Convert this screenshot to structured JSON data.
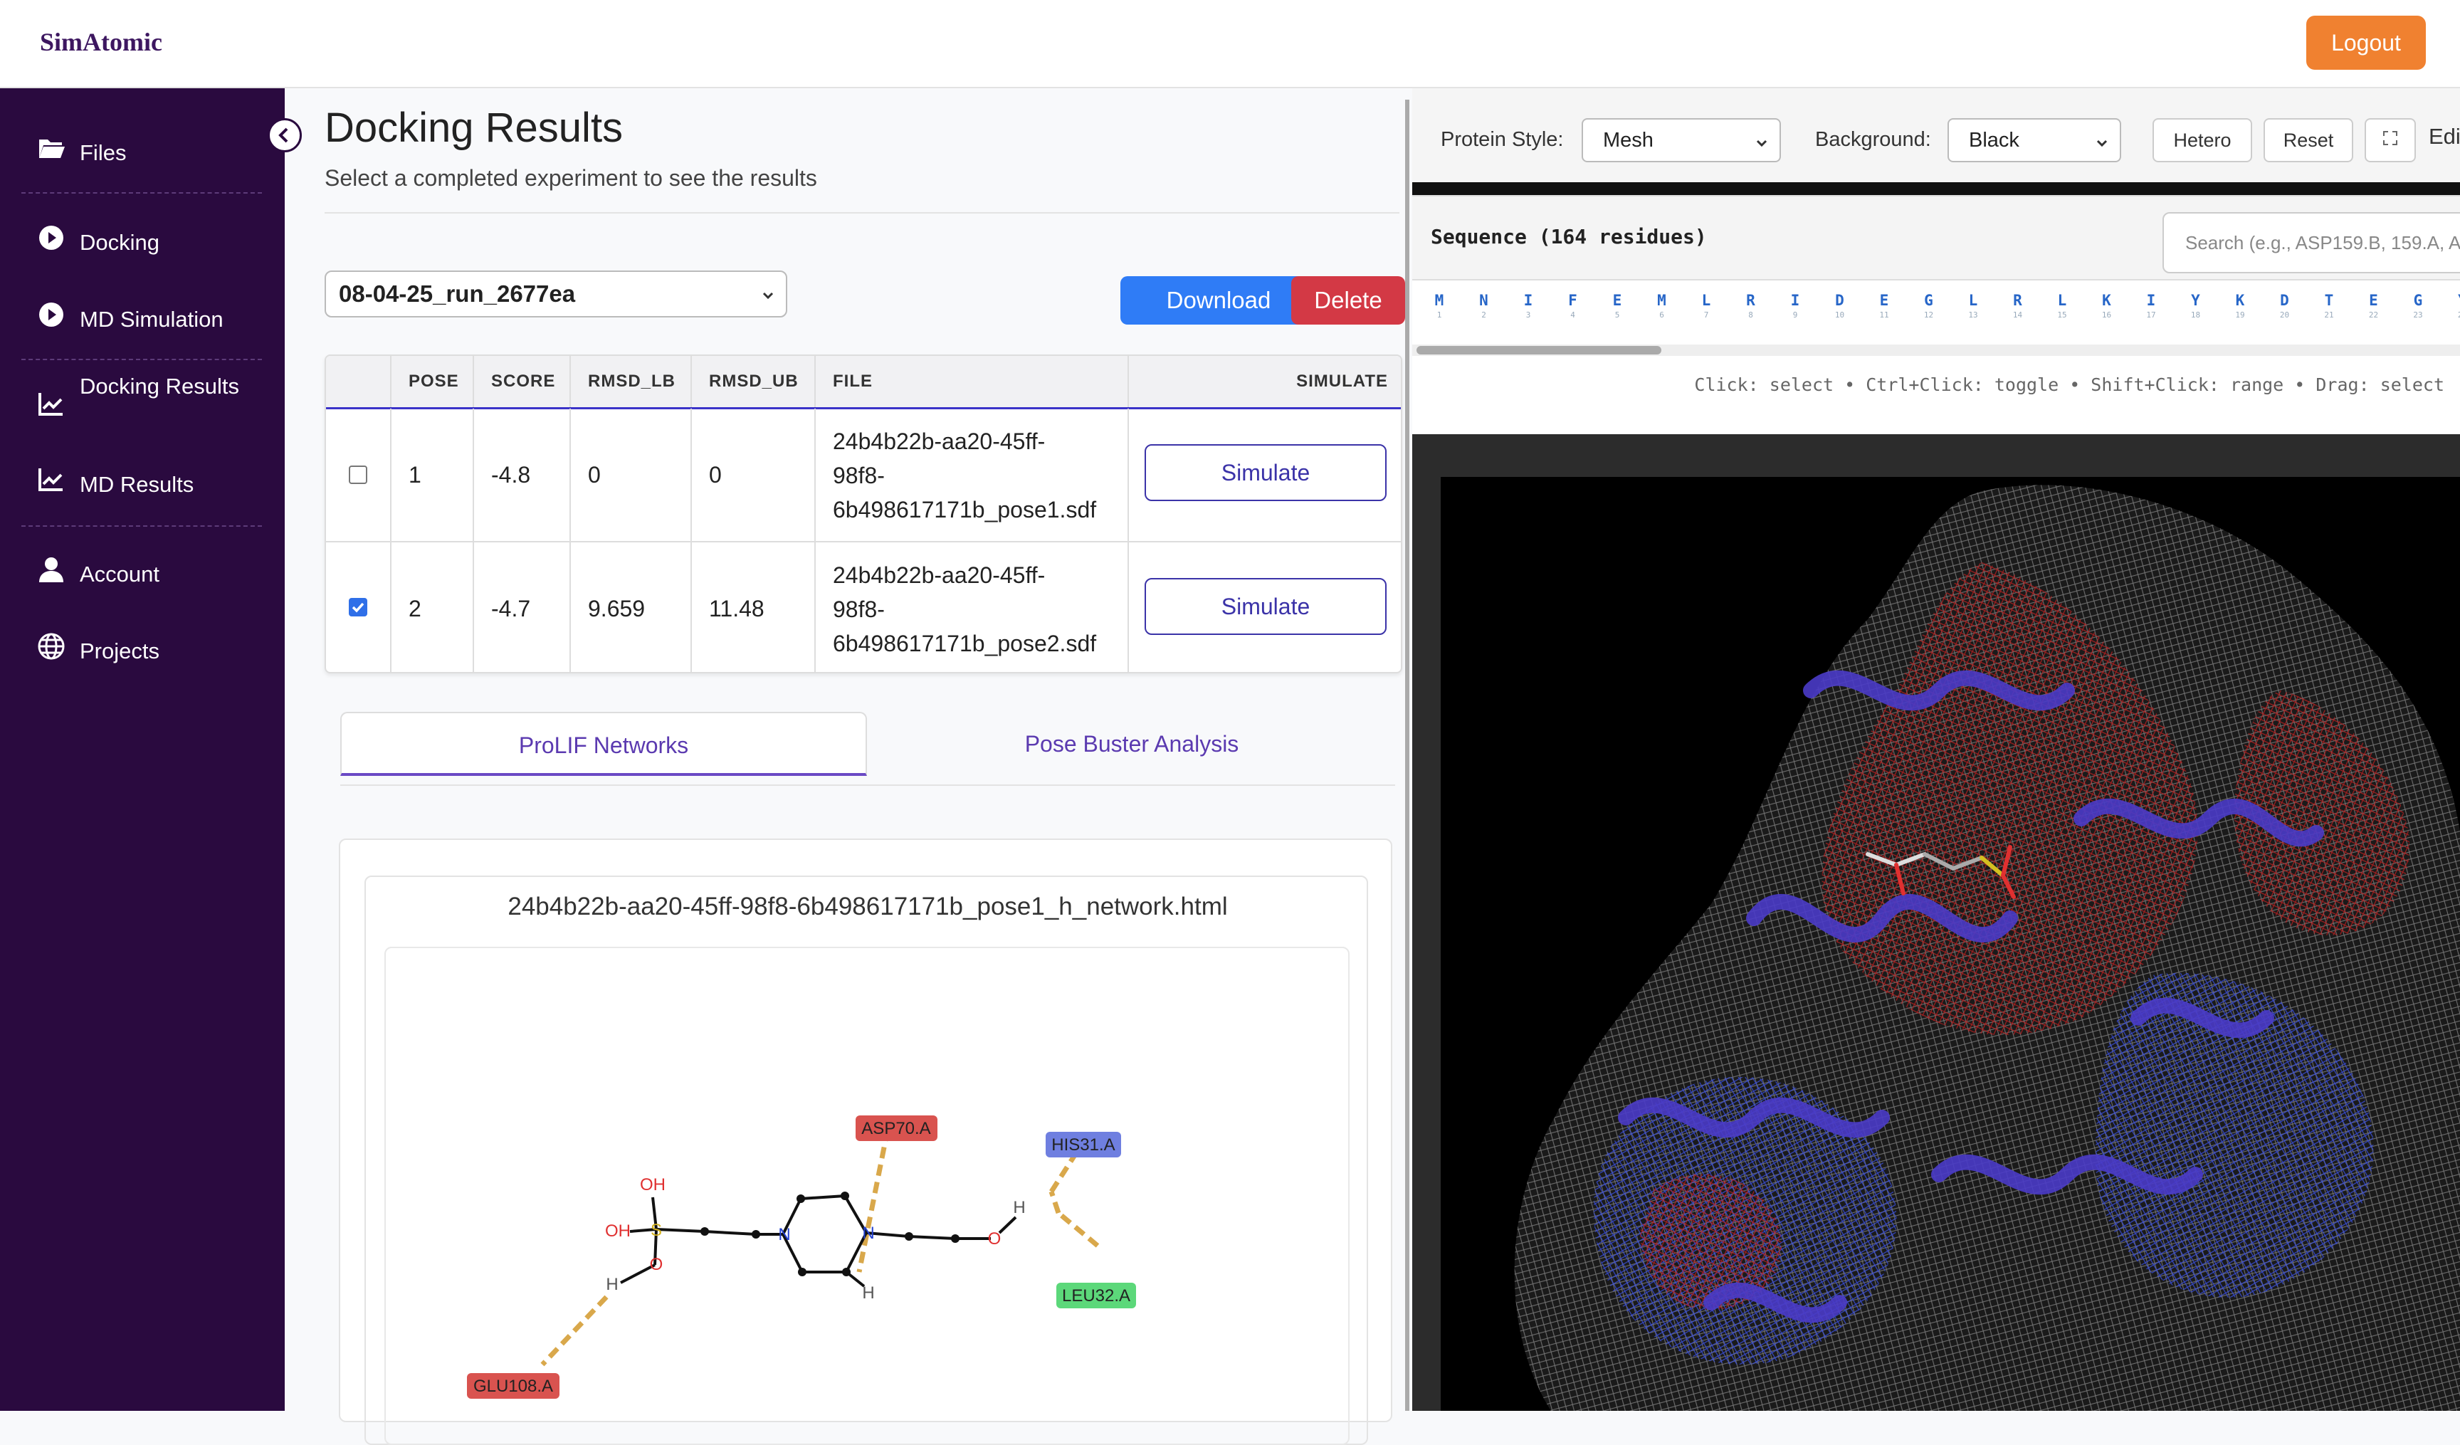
{
  "header": {
    "brand": "SimAtomic",
    "logout_label": "Logout"
  },
  "sidebar": {
    "items": [
      {
        "label": "Files",
        "icon": "folder-open-icon"
      },
      {
        "label": "Docking",
        "icon": "play-circle-icon"
      },
      {
        "label": "MD Simulation",
        "icon": "play-circle-icon"
      },
      {
        "label": "Docking Results",
        "icon": "chart-line-icon"
      },
      {
        "label": "MD Results",
        "icon": "chart-line-icon"
      },
      {
        "label": "Account",
        "icon": "user-icon"
      },
      {
        "label": "Projects",
        "icon": "globe-icon"
      }
    ]
  },
  "main": {
    "title": "Docking Results",
    "subtitle": "Select a completed experiment to see the results",
    "experiment": "08-04-25_run_2677ea",
    "download_label": "Download",
    "delete_label": "Delete",
    "table": {
      "headers": [
        "",
        "POSE",
        "SCORE",
        "RMSD_LB",
        "RMSD_UB",
        "FILE",
        "SIMULATE"
      ],
      "rows": [
        {
          "checked": false,
          "pose": "1",
          "score": "-4.8",
          "rmsd_lb": "0",
          "rmsd_ub": "0",
          "file1": "24b4b22b-aa20-45ff-",
          "file2": "98f8-",
          "file3": "6b498617171b_pose1.sdf",
          "action": "Simulate"
        },
        {
          "checked": true,
          "pose": "2",
          "score": "-4.7",
          "rmsd_lb": "9.659",
          "rmsd_ub": "11.48",
          "file1": "24b4b22b-aa20-45ff-",
          "file2": "98f8-",
          "file3": "6b498617171b_pose2.sdf",
          "action": "Simulate"
        }
      ]
    },
    "tabs": [
      {
        "label": "ProLIF Networks",
        "active": true
      },
      {
        "label": "Pose Buster Analysis",
        "active": false
      }
    ],
    "network": {
      "filename": "24b4b22b-aa20-45ff-98f8-6b498617171b_pose1_h_network.html",
      "residues": [
        {
          "label": "ASP70.A",
          "color": "#d9534f"
        },
        {
          "label": "HIS31.A",
          "color": "#6f7fe0"
        },
        {
          "label": "LEU32.A",
          "color": "#5cd87a"
        },
        {
          "label": "GLU108.A",
          "color": "#d9534f"
        }
      ],
      "atoms": {
        "oh1": "OH",
        "oh2": "OH",
        "s": "S",
        "o1": "O",
        "h1": "H",
        "n1": "N",
        "n2": "N",
        "h2": "H",
        "o2": "O",
        "h3": "H"
      }
    }
  },
  "viewer": {
    "protein_style_label": "Protein Style:",
    "protein_style": "Mesh",
    "background_label": "Background:",
    "background": "Black",
    "hetero_label": "Hetero",
    "reset_label": "Reset",
    "edit_label": "Edi",
    "sequence_title": "Sequence (164 residues)",
    "search_placeholder": "Search (e.g., ASP159.B, 159.A, A",
    "residues": [
      "M",
      "N",
      "I",
      "F",
      "E",
      "M",
      "L",
      "R",
      "I",
      "D",
      "E",
      "G",
      "L",
      "R",
      "L",
      "K",
      "I",
      "Y",
      "K",
      "D",
      "T",
      "E",
      "G",
      "Y"
    ],
    "help": "Click: select • Ctrl+Click: toggle • Shift+Click: range • Drag: select"
  }
}
